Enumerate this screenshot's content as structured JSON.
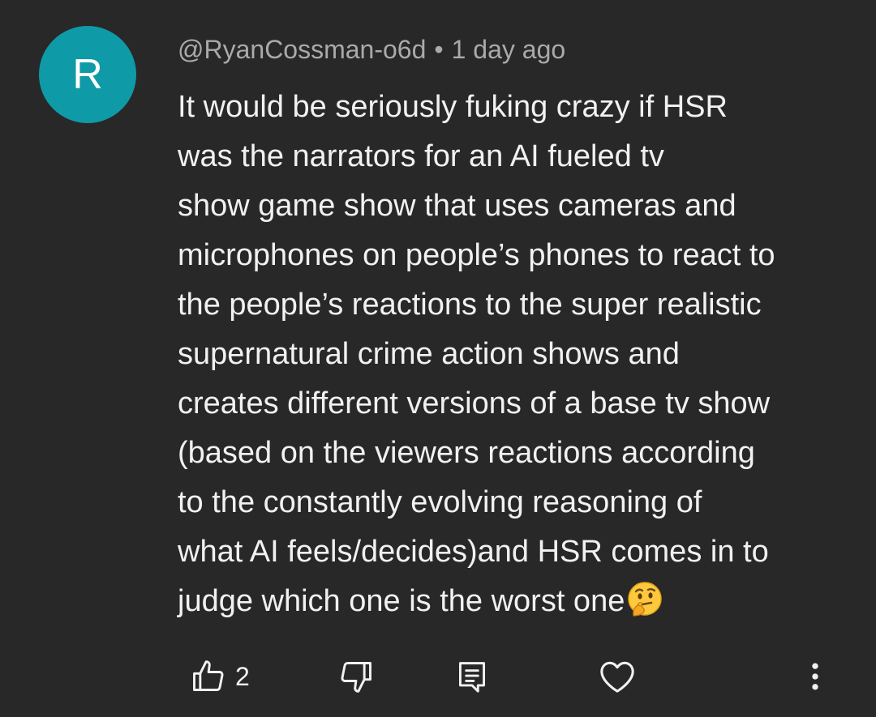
{
  "comment": {
    "avatar_letter": "R",
    "avatar_color": "#0f9aa8",
    "author": "@RyanCossman-o6d",
    "separator": "•",
    "timestamp": "1 day ago",
    "text_lines": [
      "It would be seriously fuking crazy if HSR",
      "was the narrators for an AI fueled tv",
      "show game show that uses cameras and",
      "microphones on people’s phones to react to",
      "the people’s reactions to the super realistic",
      "supernatural crime action shows and",
      "creates different versions of a base tv show",
      "(based on the viewers reactions according",
      "to the constantly evolving reasoning of",
      "what AI feels/decides)and HSR comes in to",
      "judge which one is the worst one"
    ],
    "trailing_emoji": "thinking-face-emoji"
  },
  "actions": {
    "like_icon": "thumbs-up-icon",
    "like_count": "2",
    "dislike_icon": "thumbs-down-icon",
    "reply_icon": "reply-comment-icon",
    "heart_icon": "heart-icon",
    "more_icon": "more-vertical-icon"
  }
}
